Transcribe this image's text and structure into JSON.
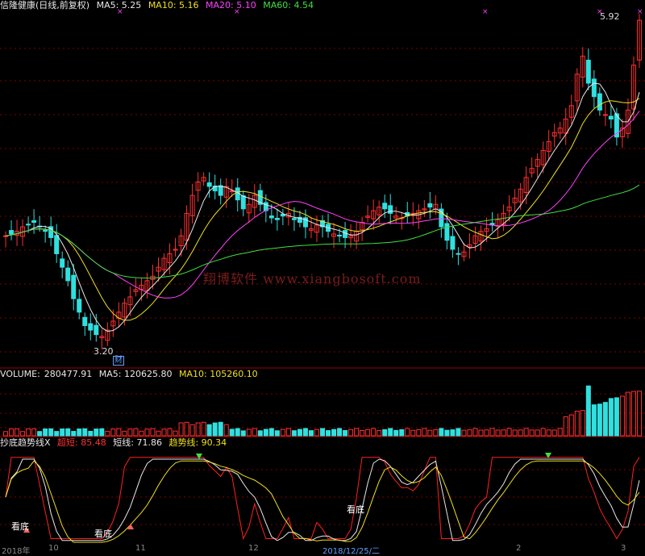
{
  "window": {
    "title": "信隆健康(日线,前复权)"
  },
  "main_panel": {
    "ma_labels": [
      {
        "label": "MA5: 5.25",
        "color": "#e8e8e8"
      },
      {
        "label": "MA10: 5.16",
        "color": "#f0e020"
      },
      {
        "label": "MA20: 5.10",
        "color": "#ff40ff"
      },
      {
        "label": "MA60: 4.54",
        "color": "#40e040"
      }
    ],
    "high_label": "5.92",
    "low_label": "3.20",
    "badge": "财",
    "watermark": "翔博软件 www.xiangbosoft.com"
  },
  "volume_panel": {
    "title": "VOLUME:",
    "volume_value": "280477.91",
    "ma5_label": "MA5: 120625.80",
    "ma10_label": "MA10: 105260.10"
  },
  "indicator_panel": {
    "name": "抄底趋势线X",
    "items": [
      {
        "label": "超短: 85.48",
        "color": "#ff3030"
      },
      {
        "label": "短线: 71.86",
        "color": "#e8e8e8"
      },
      {
        "label": "趋势线: 90.34",
        "color": "#f0e020"
      }
    ],
    "annotations": [
      "看底",
      "看底",
      "看底"
    ]
  },
  "x_axis": {
    "labels": [
      "2018年",
      "10",
      "11",
      "12",
      "2018/12/25/二",
      "2",
      "3"
    ]
  },
  "colors": {
    "up": "#ff3030",
    "down": "#30e0e0",
    "ma5": "#e8e8e8",
    "ma10": "#f0e020",
    "ma20": "#ff40ff",
    "ma60": "#40e040",
    "grid": "#800000"
  },
  "chart_data": {
    "type": "candlestick",
    "closes": [
      4.4,
      4.42,
      4.45,
      4.5,
      4.52,
      4.55,
      4.5,
      4.45,
      4.38,
      4.2,
      4.05,
      3.9,
      3.7,
      3.55,
      3.4,
      3.35,
      3.3,
      3.28,
      3.35,
      3.45,
      3.55,
      3.65,
      3.72,
      3.8,
      3.85,
      3.9,
      3.95,
      4.05,
      4.15,
      4.2,
      4.25,
      4.4,
      4.65,
      4.85,
      5.0,
      5.05,
      4.95,
      4.9,
      4.85,
      4.95,
      4.9,
      4.8,
      4.7,
      4.75,
      4.85,
      4.75,
      4.68,
      4.6,
      4.58,
      4.62,
      4.65,
      4.58,
      4.55,
      4.5,
      4.48,
      4.52,
      4.5,
      4.45,
      4.42,
      4.4,
      4.38,
      4.4,
      4.45,
      4.55,
      4.62,
      4.68,
      4.72,
      4.7,
      4.65,
      4.62,
      4.6,
      4.62,
      4.65,
      4.68,
      4.7,
      4.72,
      4.75,
      4.5,
      4.35,
      4.25,
      4.2,
      4.22,
      4.3,
      4.4,
      4.45,
      4.48,
      4.52,
      4.58,
      4.65,
      4.72,
      4.82,
      4.92,
      5.05,
      5.15,
      5.25,
      5.35,
      5.45,
      5.55,
      5.6,
      5.7,
      5.85,
      6.2,
      6.4,
      6.1,
      5.95,
      5.8,
      5.75,
      5.7,
      5.5,
      5.6,
      5.8,
      6.3,
      6.8
    ],
    "ma5_last": 5.25,
    "ma10_last": 5.16,
    "ma20_last": 5.1,
    "ma60_last": 4.54,
    "high": 5.92,
    "low": 3.2,
    "volume_last": 280477.91,
    "volume_ma5": 120625.8,
    "volume_ma10": 105260.1,
    "indicator": {
      "超短": 85.48,
      "短线": 71.86,
      "趋势线": 90.34
    }
  }
}
